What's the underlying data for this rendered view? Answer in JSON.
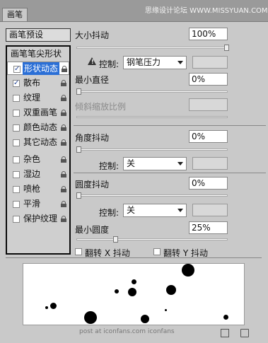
{
  "window": {
    "tab": "画笔",
    "watermark": "思缘设计论坛 WWW.MISSYUAN.COM"
  },
  "left_panel": {
    "preset_button": "画笔预设",
    "header": "画笔笔尖形状",
    "items": [
      {
        "label": "形状动态",
        "checked": true,
        "selected": true,
        "locked": true
      },
      {
        "label": "散布",
        "checked": true,
        "selected": false,
        "locked": true
      },
      {
        "label": "纹理",
        "checked": false,
        "selected": false,
        "locked": true
      },
      {
        "label": "双重画笔",
        "checked": false,
        "selected": false,
        "locked": true
      },
      {
        "label": "颜色动态",
        "checked": false,
        "selected": false,
        "locked": true
      },
      {
        "label": "其它动态",
        "checked": false,
        "selected": false,
        "locked": true
      },
      {
        "label": "杂色",
        "checked": false,
        "selected": false,
        "locked": true
      },
      {
        "label": "湿边",
        "checked": false,
        "selected": false,
        "locked": true
      },
      {
        "label": "喷枪",
        "checked": false,
        "selected": false,
        "locked": true
      },
      {
        "label": "平滑",
        "checked": false,
        "selected": false,
        "locked": true
      },
      {
        "label": "保护纹理",
        "checked": false,
        "selected": false,
        "locked": true
      }
    ]
  },
  "settings": {
    "size_jitter_label": "大小抖动",
    "size_jitter_value": "100%",
    "control_label": "控制:",
    "size_control_value": "钢笔压力",
    "min_diameter_label": "最小直径",
    "min_diameter_value": "0%",
    "tilt_scale_label": "倾斜缩放比例",
    "angle_jitter_label": "角度抖动",
    "angle_jitter_value": "0%",
    "angle_control_value": "关",
    "roundness_jitter_label": "圆度抖动",
    "roundness_jitter_value": "0%",
    "roundness_control_value": "关",
    "min_roundness_label": "最小圆度",
    "min_roundness_value": "25%",
    "flip_x_label": "翻转 X 抖动",
    "flip_y_label": "翻转 Y 抖动"
  },
  "preview": {
    "watermark": "post at iconfans.com   iconfans"
  }
}
